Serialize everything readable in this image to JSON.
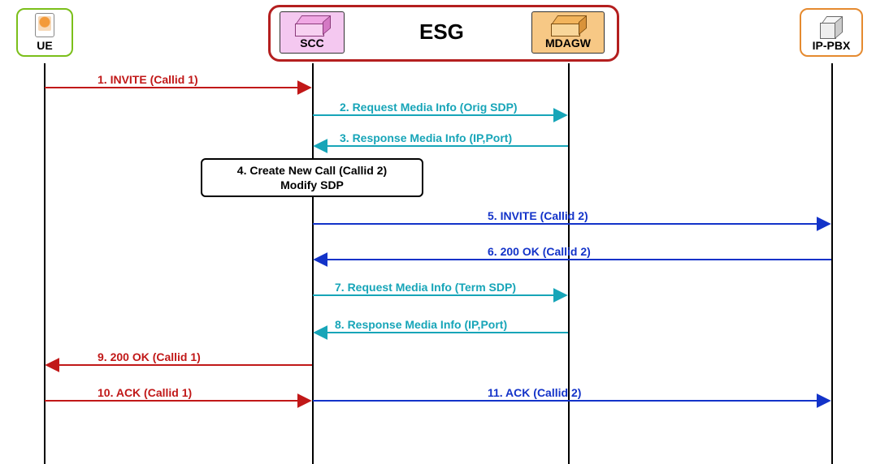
{
  "nodes": {
    "ue": {
      "label": "UE"
    },
    "scc": {
      "label": "SCC"
    },
    "group": {
      "label": "ESG"
    },
    "mdagw": {
      "label": "MDAGW"
    },
    "ippbx": {
      "label": "IP-PBX"
    }
  },
  "note": {
    "line1": "4. Create New Call (Callid 2)",
    "line2": "Modify SDP"
  },
  "messages": {
    "m1": "1. INVITE (Callid 1)",
    "m2": "2. Request Media Info (Orig SDP)",
    "m3": "3. Response Media Info (IP,Port)",
    "m5": "5. INVITE (Callid 2)",
    "m6": "6. 200 OK (Callid 2)",
    "m7": "7. Request Media Info (Term SDP)",
    "m8": "8. Response Media Info (IP,Port)",
    "m9": "9. 200 OK (Callid 1)",
    "m10": "10. ACK (Callid 1)",
    "m11": "11. ACK (Callid 2)"
  },
  "colors": {
    "red": "#c11818",
    "cyan": "#17a5b8",
    "blue": "#1333c9"
  },
  "chart_data": {
    "type": "sequence-diagram",
    "participants": [
      "UE",
      "SCC",
      "MDAGW",
      "IP-PBX"
    ],
    "group": {
      "name": "ESG",
      "members": [
        "SCC",
        "MDAGW"
      ]
    },
    "events": [
      {
        "n": 1,
        "from": "UE",
        "to": "SCC",
        "label": "INVITE (Callid 1)",
        "color": "red"
      },
      {
        "n": 2,
        "from": "SCC",
        "to": "MDAGW",
        "label": "Request Media Info (Orig SDP)",
        "color": "cyan"
      },
      {
        "n": 3,
        "from": "MDAGW",
        "to": "SCC",
        "label": "Response Media Info (IP,Port)",
        "color": "cyan"
      },
      {
        "n": 4,
        "at": "SCC",
        "type": "note",
        "label": "Create New Call (Callid 2) / Modify SDP"
      },
      {
        "n": 5,
        "from": "SCC",
        "to": "IP-PBX",
        "label": "INVITE (Callid 2)",
        "color": "blue"
      },
      {
        "n": 6,
        "from": "IP-PBX",
        "to": "SCC",
        "label": "200 OK (Callid 2)",
        "color": "blue"
      },
      {
        "n": 7,
        "from": "SCC",
        "to": "MDAGW",
        "label": "Request Media Info (Term SDP)",
        "color": "cyan"
      },
      {
        "n": 8,
        "from": "MDAGW",
        "to": "SCC",
        "label": "Response Media Info (IP,Port)",
        "color": "cyan"
      },
      {
        "n": 9,
        "from": "SCC",
        "to": "UE",
        "label": "200 OK (Callid 1)",
        "color": "red"
      },
      {
        "n": 10,
        "from": "UE",
        "to": "SCC",
        "label": "ACK (Callid 1)",
        "color": "red"
      },
      {
        "n": 11,
        "from": "SCC",
        "to": "IP-PBX",
        "label": "ACK (Callid 2)",
        "color": "blue"
      }
    ]
  }
}
